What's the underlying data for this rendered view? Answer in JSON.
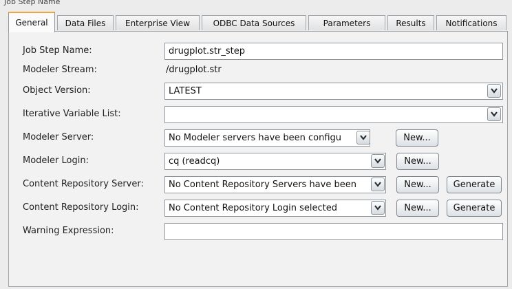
{
  "window": {
    "top_text": "Job Step Name"
  },
  "tabs": [
    {
      "label": "General",
      "active": true
    },
    {
      "label": "Data Files"
    },
    {
      "label": "Enterprise View"
    },
    {
      "label": "ODBC Data Sources"
    },
    {
      "label": "Parameters"
    },
    {
      "label": "Results"
    },
    {
      "label": "Notifications"
    }
  ],
  "form": {
    "job_step_name": {
      "label": "Job Step Name:",
      "value": "drugplot.str_step"
    },
    "modeler_stream": {
      "label": "Modeler Stream:",
      "value": "/drugplot.str"
    },
    "object_version": {
      "label": "Object Version:",
      "value": "LATEST"
    },
    "iterative_variable_list": {
      "label": "Iterative Variable List:",
      "value": ""
    },
    "modeler_server": {
      "label": "Modeler Server:",
      "value": "No Modeler servers have been configu",
      "new_label": "New..."
    },
    "modeler_login": {
      "label": "Modeler Login:",
      "value": "cq (readcq)",
      "new_label": "New..."
    },
    "content_repository_server": {
      "label": "Content Repository Server:",
      "value": "No Content Repository Servers have been",
      "new_label": "New...",
      "generate_label": "Generate"
    },
    "content_repository_login": {
      "label": "Content Repository Login:",
      "value": "No Content Repository Login selected",
      "new_label": "New...",
      "generate_label": "Generate"
    },
    "warning_expression": {
      "label": "Warning Expression:",
      "value": ""
    }
  },
  "icons": {
    "dropdown": "chevron-down-icon"
  },
  "colors": {
    "active_tab_accent": "#f1a43a",
    "panel_bg": "#f2f2f2",
    "window_bg": "#ececec"
  }
}
